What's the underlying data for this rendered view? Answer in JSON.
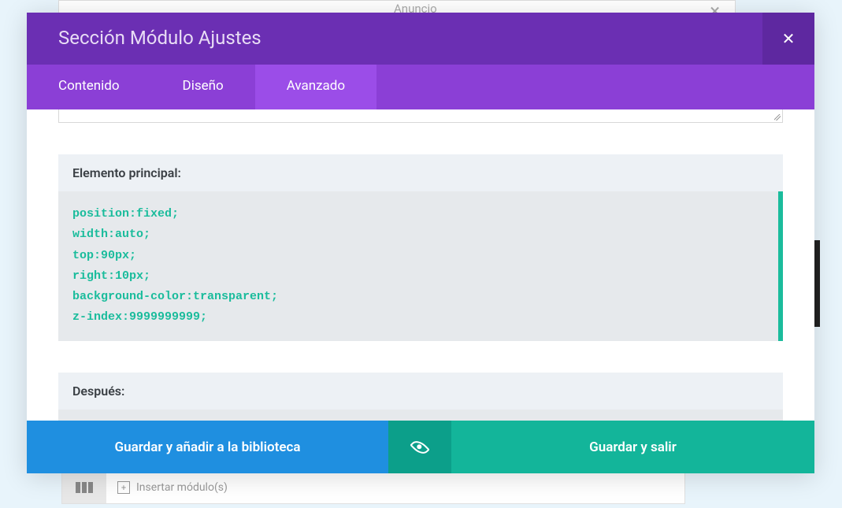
{
  "background": {
    "module_label": "Anuncio",
    "insert_label": "Insertar módulo(s)"
  },
  "modal": {
    "title": "Sección Módulo Ajustes",
    "close_symbol": "✕"
  },
  "tabs": {
    "content": "Contenido",
    "design": "Diseño",
    "advanced": "Avanzado"
  },
  "fields": {
    "main_element_label": "Elemento principal:",
    "after_label": "Después:",
    "css_lines": [
      "position:fixed;",
      "width:auto;",
      "top:90px;",
      "right:10px;",
      "background-color:transparent;",
      "z-index:9999999999;"
    ]
  },
  "footer": {
    "save_library": "Guardar y añadir a la biblioteca",
    "save_exit": "Guardar y salir"
  }
}
